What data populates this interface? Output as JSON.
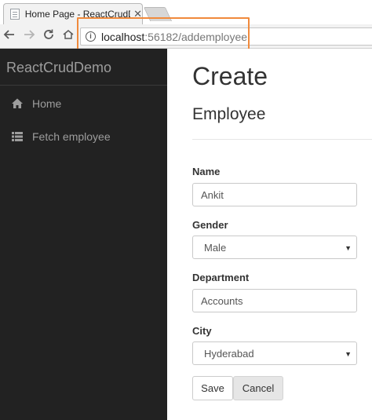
{
  "browser": {
    "tab_title": "Home Page - ReactCrudD",
    "tab_close": "✕",
    "url_host": "localhost",
    "url_rest": ":56182/addemployee",
    "info_glyph": "i",
    "icons": [
      "back-icon",
      "forward-icon",
      "reload-icon",
      "home-icon"
    ],
    "highlight_color": "#f08a3c"
  },
  "sidebar": {
    "brand": "ReactCrudDemo",
    "items": [
      {
        "label": "Home",
        "icon": "home-icon"
      },
      {
        "label": "Fetch employee",
        "icon": "list-icon"
      }
    ],
    "bg_color": "#222222",
    "text_color": "#9d9d9d"
  },
  "main": {
    "title": "Create",
    "subtitle": "Employee",
    "form": {
      "name_label": "Name",
      "name_value": "Ankit",
      "gender_label": "Gender",
      "gender_value": "Male",
      "department_label": "Department",
      "department_value": "Accounts",
      "city_label": "City",
      "city_value": "Hyderabad"
    },
    "buttons": {
      "save": "Save",
      "cancel": "Cancel"
    }
  }
}
